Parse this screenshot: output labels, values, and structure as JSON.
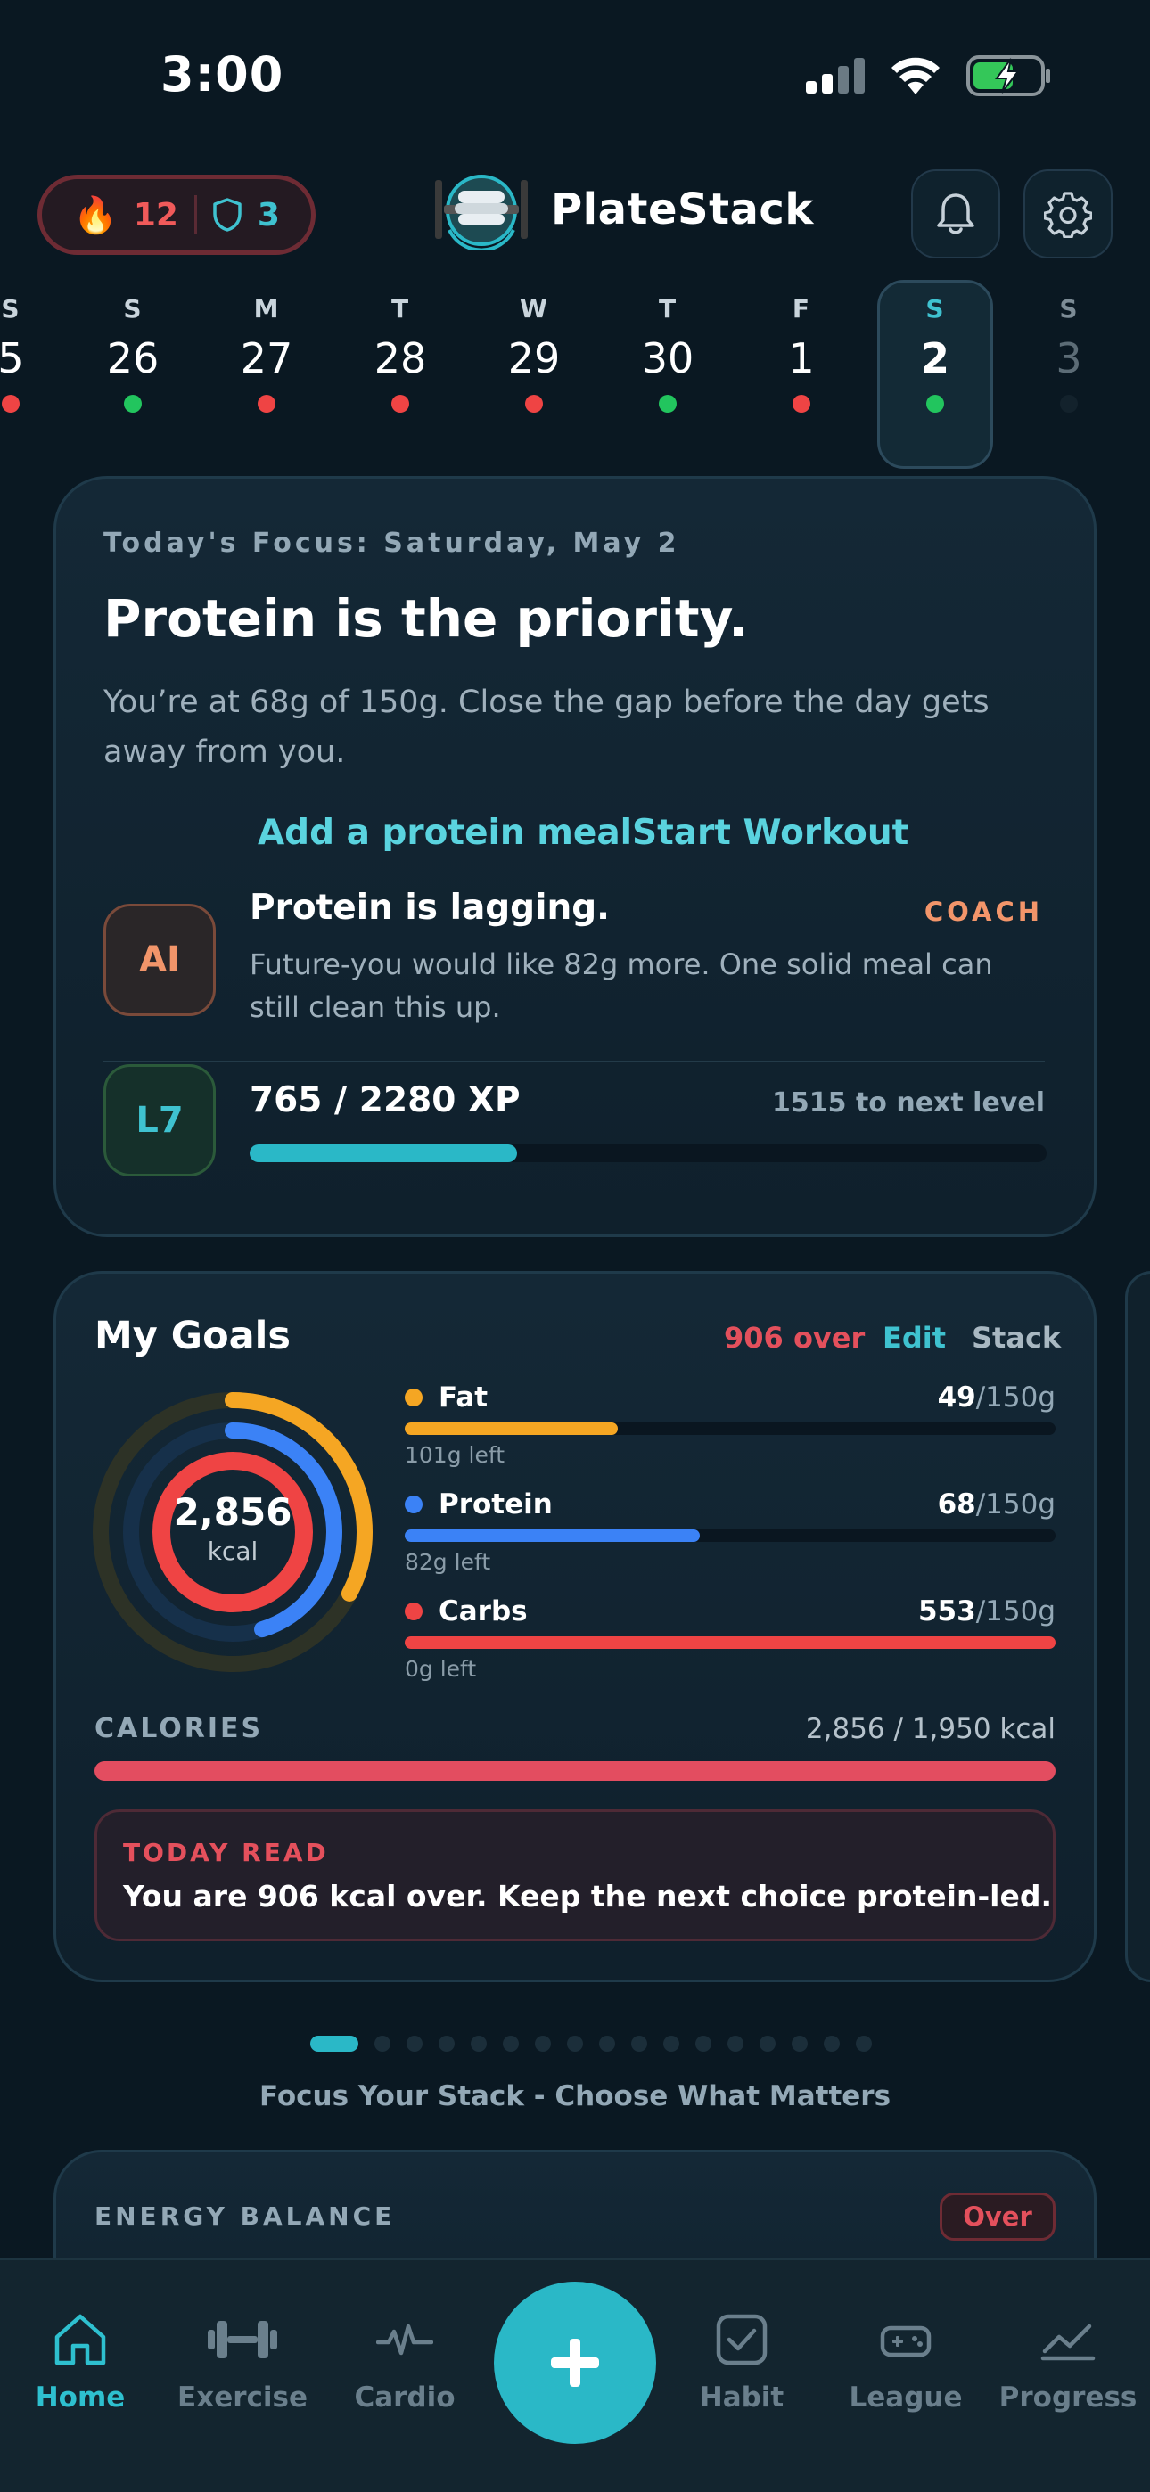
{
  "status_bar": {
    "time": "3:00"
  },
  "header": {
    "streak_count": "12",
    "shield_count": "3",
    "brand": "PlateStack"
  },
  "calendar": {
    "days": [
      {
        "letter": "S",
        "num": "5",
        "status": "red"
      },
      {
        "letter": "S",
        "num": "26",
        "status": "green"
      },
      {
        "letter": "M",
        "num": "27",
        "status": "red"
      },
      {
        "letter": "T",
        "num": "28",
        "status": "red"
      },
      {
        "letter": "W",
        "num": "29",
        "status": "red"
      },
      {
        "letter": "T",
        "num": "30",
        "status": "green"
      },
      {
        "letter": "F",
        "num": "1",
        "status": "red"
      },
      {
        "letter": "S",
        "num": "2",
        "status": "green",
        "selected": true
      },
      {
        "letter": "S",
        "num": "3",
        "status": "none"
      }
    ]
  },
  "focus": {
    "date_label": "Today's Focus: Saturday, May 2",
    "title": "Protein is the priority.",
    "body": "You’re at 68g of 150g. Close the gap before the day gets away from you.",
    "action_1": "Add a protein meal",
    "action_2": "Start Workout",
    "coach": {
      "badge": "AI",
      "title": "Protein is lagging.",
      "tag": "COACH",
      "body": "Future-you would like 82g more. One solid meal can still clean this up."
    },
    "level": {
      "badge": "L7",
      "xp": "765 / 2280 XP",
      "next": "1515 to next level",
      "progress": 0.336
    }
  },
  "goals": {
    "title": "My Goals",
    "over": "906 over",
    "edit": "Edit",
    "stack": "Stack",
    "ring_value": "2,856",
    "ring_unit": "kcal",
    "macros": [
      {
        "name": "Fat",
        "value": "49",
        "total": "/150g",
        "left": "101g left",
        "progress": 0.327,
        "color": "#f5a623"
      },
      {
        "name": "Protein",
        "value": "68",
        "total": "/150g",
        "left": "82g left",
        "progress": 0.453,
        "color": "#3b82f6"
      },
      {
        "name": "Carbs",
        "value": "553",
        "total": "/150g",
        "left": "0g left",
        "progress": 1.0,
        "color": "#ef4444"
      }
    ],
    "calories_label": "CALORIES",
    "calories_value": "2,856 / 1,950 kcal",
    "calories_progress": 1.0,
    "read_label": "TODAY READ",
    "read_text": "You are 906 kcal over. Keep the next choice protein-led."
  },
  "pager": {
    "caption": "Focus Your Stack - Choose What Matters",
    "pages": 17,
    "active": 0
  },
  "energy": {
    "label": "ENERGY BALANCE",
    "badge": "Over"
  },
  "nav": {
    "items": [
      {
        "label": "Home",
        "icon": "home-icon",
        "active": true
      },
      {
        "label": "Exercise",
        "icon": "dumbbell-icon"
      },
      {
        "label": "Cardio",
        "icon": "pulse-icon"
      },
      {
        "label": "Habit",
        "icon": "checkbox-icon"
      },
      {
        "label": "League",
        "icon": "gamepad-icon"
      },
      {
        "label": "Progress",
        "icon": "chart-line-icon"
      }
    ]
  },
  "colors": {
    "accent": "#2ec0cf",
    "danger": "#ef4444",
    "coach": "#f2956a"
  }
}
